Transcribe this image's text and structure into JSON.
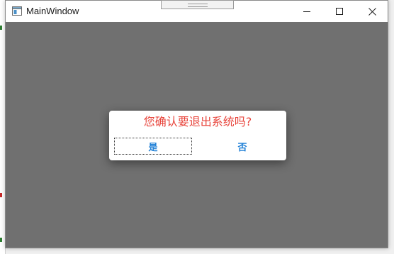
{
  "window": {
    "title": "MainWindow",
    "controls": {
      "minimize_icon": "minimize-icon",
      "maximize_icon": "maximize-icon",
      "close_icon": "close-icon"
    }
  },
  "dialog": {
    "message": "您确认要退出系统吗?",
    "yes_label": "是",
    "no_label": "否"
  },
  "colors": {
    "overlay": "#707070",
    "message_text": "#e8453c",
    "button_text": "#1e7fd6",
    "dialog_background": "#ffffff"
  }
}
